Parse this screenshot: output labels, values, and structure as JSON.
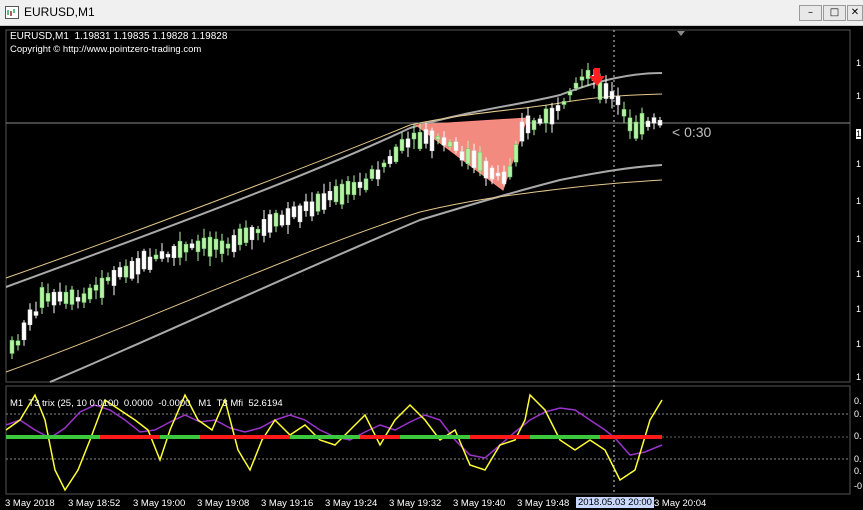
{
  "window": {
    "title": "EURUSD,M1"
  },
  "main_chart": {
    "header": "EURUSD,M1  1.19831 1.19835 1.19828 1.19828",
    "copyright": "Copyright © http://www.pointzero-trading.com",
    "countdown": "< 0:30",
    "price_axis_labels": [
      "1",
      "1",
      "1",
      "1",
      "1",
      "1",
      "1",
      "1",
      "1",
      "1",
      "1"
    ],
    "current_price_label": "1"
  },
  "sub_chart": {
    "header": "M1  T3 trix (25, 10 0.0100  0.0000  -0.0000   M1  T3 Mfi  52.6194",
    "axis_labels": [
      "0.",
      "0.",
      "0.",
      "0.",
      "0.",
      "-0"
    ]
  },
  "time_axis": {
    "labels": [
      "3 May 2018",
      "3 May 18:52",
      "3 May 19:00",
      "3 May 19:08",
      "3 May 19:16",
      "3 May 19:24",
      "3 May 19:32",
      "3 May 19:40",
      "3 May 19:48",
      "3 May 20:04"
    ],
    "cursor_label": "2018.05.03 20:00"
  },
  "colors": {
    "background": "#000000",
    "bull_candle": "#b6f2a4",
    "bear_candle": "#ffffff",
    "channel": "#a9a9a9",
    "thin_line": "#e6c98c",
    "pattern_fill": "#f28a80",
    "sell_arrow": "#ff2020",
    "trix_up": "#3cc83c",
    "trix_down": "#ff1a1a",
    "mfi_line": "#9933cc",
    "yellow_line": "#ffff33"
  }
}
